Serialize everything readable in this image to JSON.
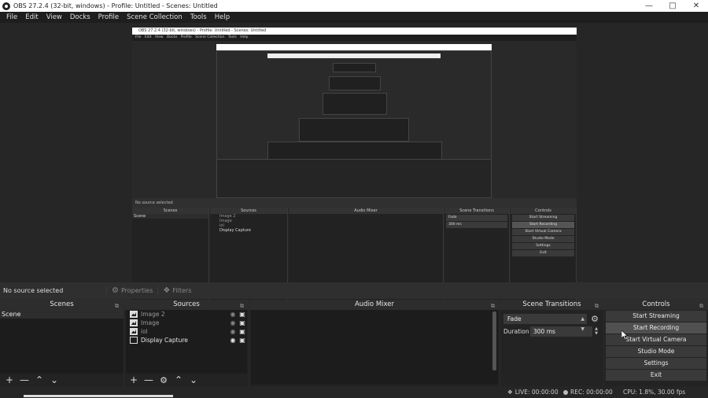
{
  "window": {
    "title": "OBS 27.2.4 (32-bit, windows) - Profile: Untitled - Scenes: Untitled"
  },
  "menu": [
    "File",
    "Edit",
    "View",
    "Docks",
    "Profile",
    "Scene Collection",
    "Tools",
    "Help"
  ],
  "source_bar": {
    "no_source": "No source selected",
    "properties": "Properties",
    "filters": "Filters"
  },
  "docks": {
    "scenes": {
      "title": "Scenes",
      "items": [
        "Scene"
      ]
    },
    "sources": {
      "title": "Sources",
      "items": [
        {
          "name": "Image 2",
          "visible": false
        },
        {
          "name": "Image",
          "visible": false
        },
        {
          "name": "iol",
          "visible": false
        },
        {
          "name": "Display Capture",
          "visible": true
        }
      ]
    },
    "mixer": {
      "title": "Audio Mixer"
    },
    "transitions": {
      "title": "Scene Transitions",
      "transition": "Fade",
      "duration_label": "Duration",
      "duration": "300 ms"
    },
    "controls": {
      "title": "Controls",
      "buttons": [
        "Start Streaming",
        "Start Recording",
        "Start Virtual Camera",
        "Studio Mode",
        "Settings",
        "Exit"
      ]
    }
  },
  "status": {
    "live": "LIVE: 00:00:00",
    "rec": "REC: 00:00:00",
    "cpu": "CPU: 1.8%, 30.00 fps"
  },
  "icons": {
    "properties": "gear-icon",
    "filters": "filter-icon",
    "visibility": "eye-icon",
    "lock": "lock-icon"
  }
}
